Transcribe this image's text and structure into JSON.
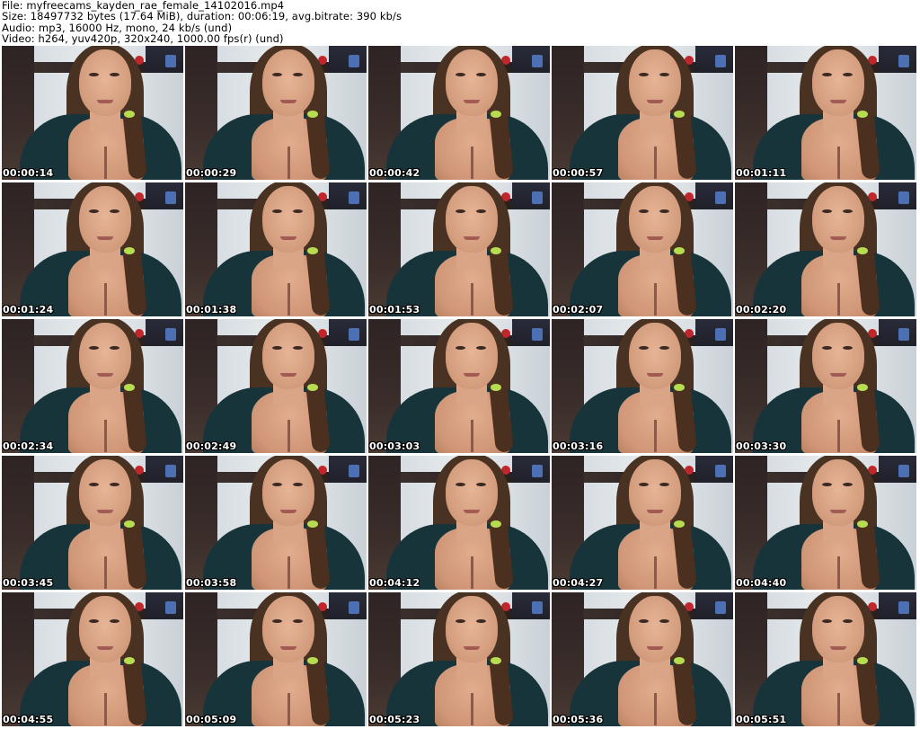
{
  "header": {
    "file_line": "File: myfreecams_kayden_rae_female_14102016.mp4",
    "size_line": "Size: 18497732 bytes (17.64 MiB), duration: 00:06:19, avg.bitrate: 390 kb/s",
    "audio_line": "Audio: mp3, 16000 Hz, mono, 24 kb/s (und)",
    "video_line": "Video: h264, yuv420p, 320x240, 1000.00 fps(r) (und)"
  },
  "thumbnails": [
    {
      "time": "00:00:14"
    },
    {
      "time": "00:00:29"
    },
    {
      "time": "00:00:42"
    },
    {
      "time": "00:00:57"
    },
    {
      "time": "00:01:11"
    },
    {
      "time": "00:01:24"
    },
    {
      "time": "00:01:38"
    },
    {
      "time": "00:01:53"
    },
    {
      "time": "00:02:07"
    },
    {
      "time": "00:02:20"
    },
    {
      "time": "00:02:34"
    },
    {
      "time": "00:02:49"
    },
    {
      "time": "00:03:03"
    },
    {
      "time": "00:03:16"
    },
    {
      "time": "00:03:30"
    },
    {
      "time": "00:03:45"
    },
    {
      "time": "00:03:58"
    },
    {
      "time": "00:04:12"
    },
    {
      "time": "00:04:27"
    },
    {
      "time": "00:04:40"
    },
    {
      "time": "00:04:55"
    },
    {
      "time": "00:05:09"
    },
    {
      "time": "00:05:23"
    },
    {
      "time": "00:05:36"
    },
    {
      "time": "00:05:51"
    }
  ]
}
